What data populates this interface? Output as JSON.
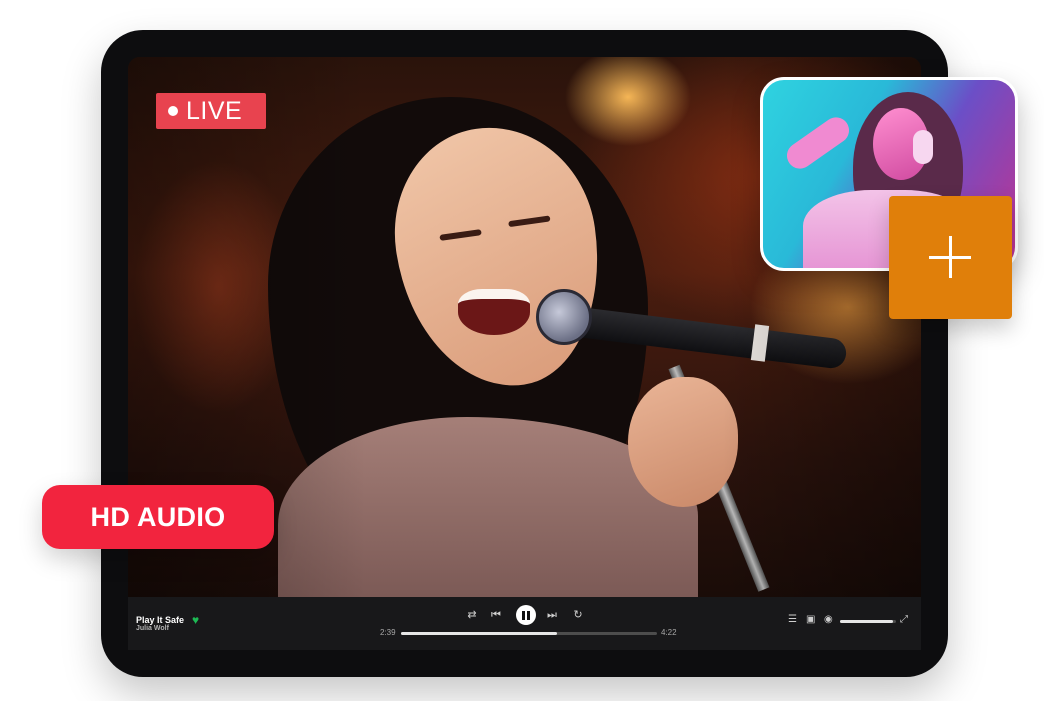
{
  "stream": {
    "live_label": "LIVE"
  },
  "badge": {
    "label": "HD AUDIO"
  },
  "player": {
    "track_title": "Play It Safe",
    "artist": "Julia Wolf",
    "liked": true,
    "elapsed": "2:39",
    "duration": "4:22",
    "progress_fraction": 0.61,
    "volume_fraction": 0.95,
    "controls": [
      "shuffle-icon",
      "previous-icon",
      "pause-icon",
      "next-icon",
      "repeat-icon"
    ],
    "right_controls": [
      "queue-icon",
      "devices-icon",
      "volume-icon",
      "fullscreen-icon"
    ]
  },
  "colors": {
    "live_red": "#e8434f",
    "hd_badge_red": "#f2243e",
    "add_orange": "#e07f0a",
    "like_green": "#1db954"
  }
}
